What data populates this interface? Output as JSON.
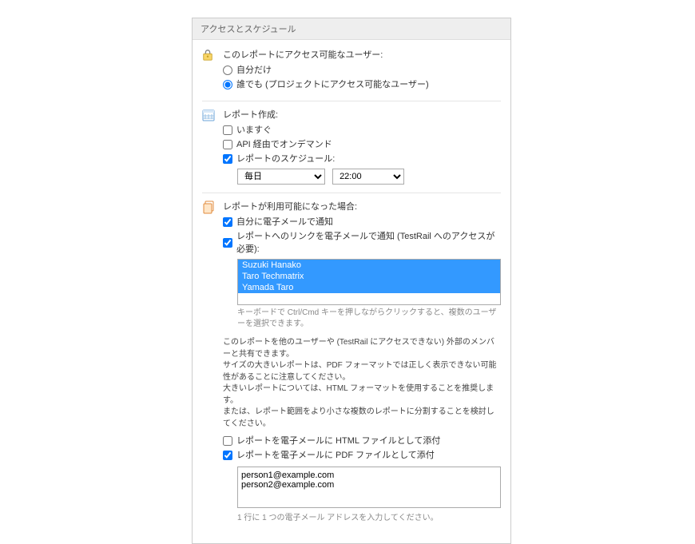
{
  "panel": {
    "title": "アクセスとスケジュール"
  },
  "access": {
    "title": "このレポートにアクセス可能なユーザー:",
    "option_self": "自分だけ",
    "option_all": "誰でも (プロジェクトにアクセス可能なユーザー)",
    "selected": "all"
  },
  "creation": {
    "title": "レポート作成:",
    "opt_now": "いますぐ",
    "opt_api": "API 経由でオンデマンド",
    "opt_schedule": "レポートのスケジュール:",
    "now_checked": false,
    "api_checked": false,
    "schedule_checked": true,
    "schedule_freq": "毎日",
    "schedule_time": "22:00"
  },
  "notify": {
    "title": "レポートが利用可能になった場合:",
    "opt_self_email": "自分に電子メールで通知",
    "opt_link_email": "レポートへのリンクを電子メールで通知 (TestRail へのアクセスが必要):",
    "self_email_checked": true,
    "link_email_checked": true,
    "users": [
      {
        "name": "Suzuki Hanako",
        "selected": true
      },
      {
        "name": "Taro Techmatrix",
        "selected": true
      },
      {
        "name": "Yamada Taro",
        "selected": true
      }
    ],
    "users_hint": "キーボードで Ctrl/Cmd キーを押しながらクリックすると、複数のユーザーを選択できます。",
    "desc_lines": [
      "このレポートを他のユーザーや (TestRail にアクセスできない) 外部のメンバーと共有できます。",
      "サイズの大きいレポートは、PDF フォーマットでは正しく表示できない可能性があることに注意してください。",
      "大きいレポートについては、HTML フォーマットを使用することを推奨します。",
      "または、レポート範囲をより小さな複数のレポートに分割することを検討してください。"
    ],
    "opt_attach_html": "レポートを電子メールに HTML ファイルとして添付",
    "opt_attach_pdf": "レポートを電子メールに PDF ファイルとして添付",
    "attach_html_checked": false,
    "attach_pdf_checked": true,
    "emails_value": "person1@example.com\nperson2@example.com",
    "emails_hint": "1 行に 1 つの電子メール アドレスを入力してください。"
  }
}
